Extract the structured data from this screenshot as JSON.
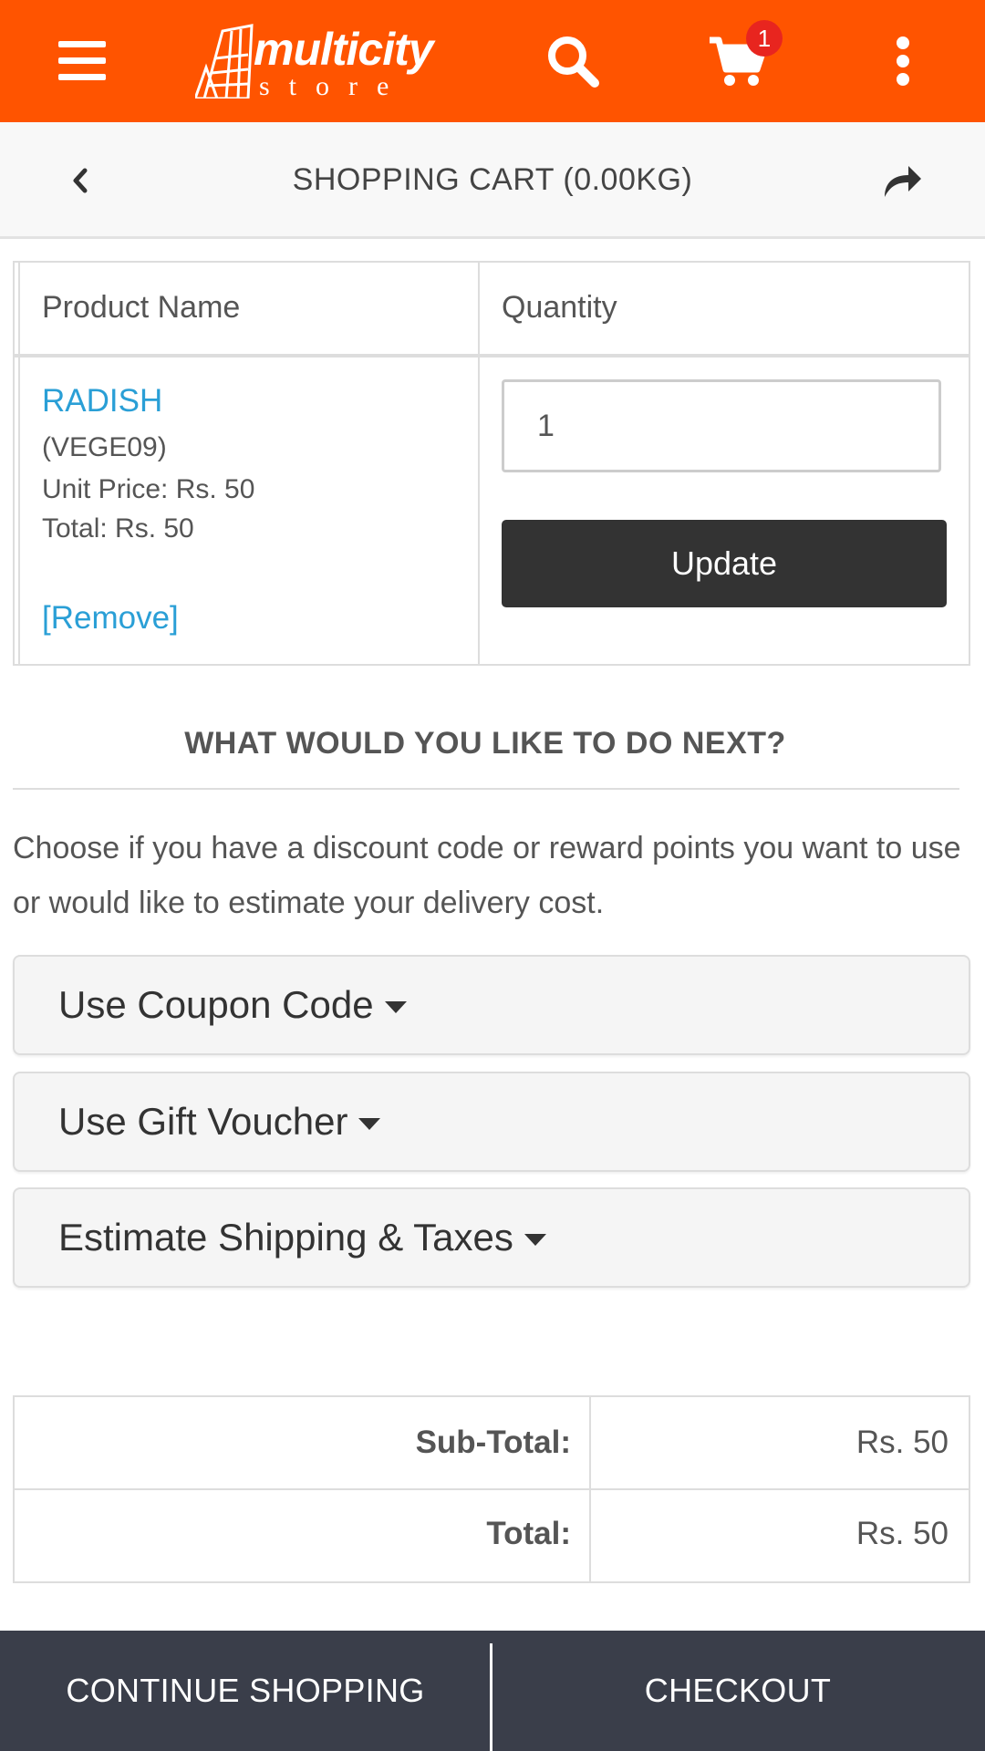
{
  "colors": {
    "brand": "#ff5400",
    "link": "#2a9fd6",
    "button_dark": "#333333",
    "bottom_bar": "#3a3e4a",
    "badge": "#e8251f"
  },
  "header": {
    "logo_name": "multicity",
    "logo_sub": "store",
    "cart_count": "1",
    "icons": [
      "menu-icon",
      "search-icon",
      "cart-icon",
      "more-vert-icon"
    ]
  },
  "subheader": {
    "title": "SHOPPING CART  (0.00KG)",
    "icons": [
      "chevron-left-icon",
      "share-icon"
    ]
  },
  "cart": {
    "col_product": "Product Name",
    "col_quantity": "Quantity",
    "items": [
      {
        "name": "RADISH",
        "code": "(VEGE09)",
        "unit_price": "Unit Price: Rs. 50",
        "total": "Total: Rs. 50",
        "remove_label": "[Remove]",
        "quantity": "1",
        "update_label": "Update"
      }
    ]
  },
  "next": {
    "heading": "WHAT WOULD YOU LIKE TO DO NEXT?",
    "description": "Choose if you have a discount code or reward points you want to use or would like to estimate your delivery cost.",
    "options": [
      "Use Coupon Code",
      "Use Gift Voucher",
      "Estimate Shipping & Taxes"
    ]
  },
  "totals": {
    "rows": [
      {
        "label": "Sub-Total:",
        "value": "Rs. 50"
      },
      {
        "label": "Total:",
        "value": "Rs. 50"
      }
    ]
  },
  "footer": {
    "continue_label": "CONTINUE SHOPPING",
    "checkout_label": "CHECKOUT"
  }
}
